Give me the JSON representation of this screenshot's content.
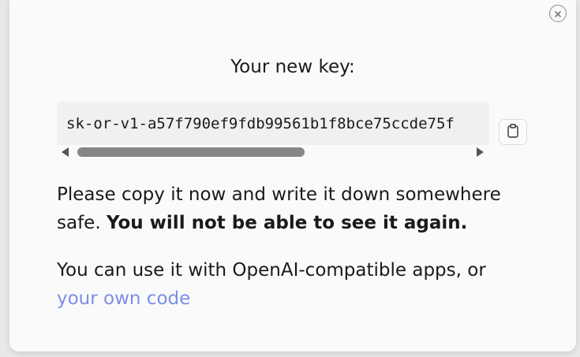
{
  "dialog": {
    "title": "Your new key:",
    "key_value": "sk-or-v1-a57f790ef9fdb99561b1f8bce75ccde75f",
    "warning_text": "Please copy it now and write it down somewhere safe.",
    "warning_bold": "You will not be able to see it again.",
    "usage_text": "You can use it with OpenAI-compatible apps, or",
    "usage_link": "your own code"
  },
  "icons": {
    "close": "close-icon",
    "copy": "clipboard-icon",
    "scroll_left": "scroll-left-arrow-icon",
    "scroll_right": "scroll-right-arrow-icon"
  },
  "colors": {
    "link": "#7b8ee6",
    "background": "#fafafa",
    "key_box": "#f0f0f0"
  },
  "scrollbar": {
    "position_fraction": 0
  }
}
